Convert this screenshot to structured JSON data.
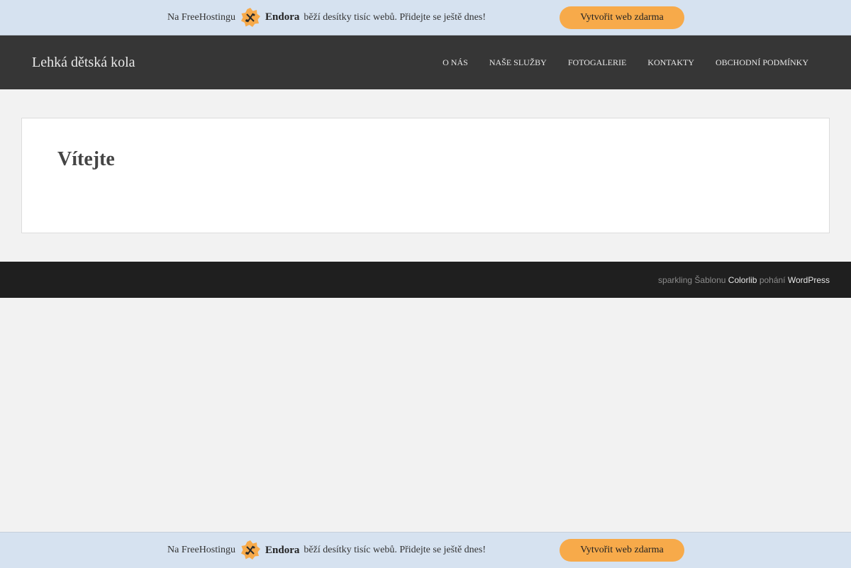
{
  "promo": {
    "prefix": "Na FreeHostingu",
    "brand": "Endora",
    "suffix": "běží desítky tisíc webů. Přidejte se ještě dnes!",
    "cta": "Vytvořit web zdarma",
    "logo_icon": "endora-logo-icon",
    "accent_color": "#f7aa4a"
  },
  "header": {
    "site_title": "Lehká dětská kola",
    "nav": [
      "O nás",
      "Naše služby",
      "Fotogalerie",
      "Kontakty",
      "Obchodní podmínky"
    ]
  },
  "main": {
    "title": "Vítejte"
  },
  "footer": {
    "theme": "sparkling",
    "by_text": "Šablonu",
    "colorlib": "Colorlib",
    "powered": "pohání",
    "wordpress": "WordPress"
  }
}
